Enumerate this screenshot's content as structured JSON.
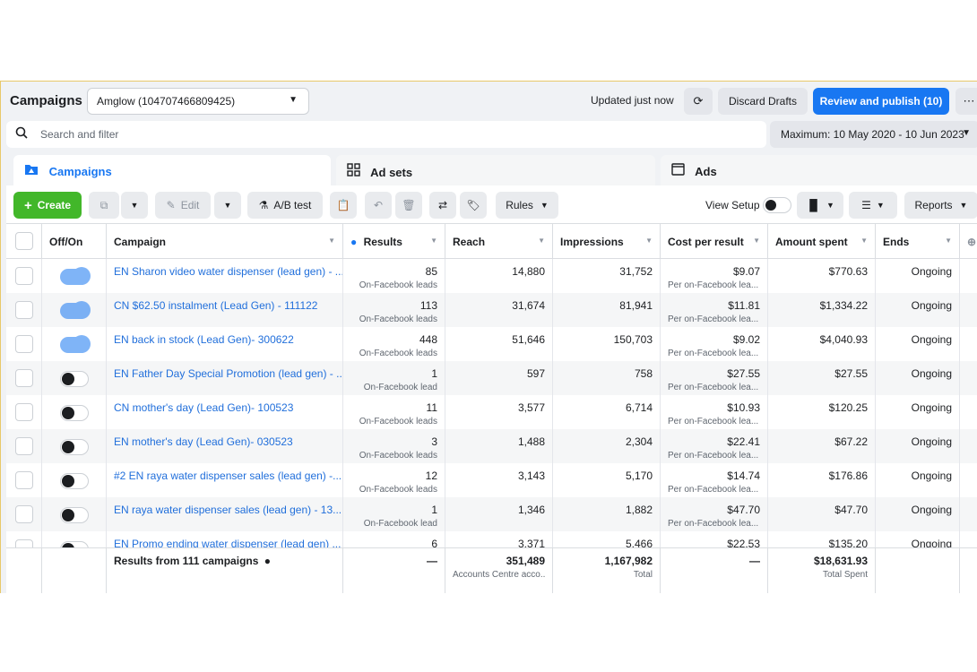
{
  "header": {
    "title": "Campaigns",
    "account": "Amglow (104707466809425)",
    "updated": "Updated just now",
    "discard": "Discard Drafts",
    "publish": "Review and publish (10)",
    "more": "⋯"
  },
  "search": {
    "placeholder": "Search and filter",
    "date_range": "Maximum: 10 May 2020 - 10 Jun 2023"
  },
  "tabs": [
    {
      "label": "Campaigns",
      "active": true
    },
    {
      "label": "Ad sets",
      "active": false
    },
    {
      "label": "Ads",
      "active": false
    }
  ],
  "toolbar": {
    "create": "Create",
    "edit": "Edit",
    "ab_test": "A/B test",
    "rules": "Rules",
    "view_setup": "View Setup",
    "reports": "Reports"
  },
  "columns": [
    "Off/On",
    "Campaign",
    "Results",
    "Reach",
    "Impressions",
    "Cost per result",
    "Amount spent",
    "Ends"
  ],
  "rows": [
    {
      "on": true,
      "name": "EN Sharon video water dispenser (lead gen) - ...",
      "results": "85",
      "results_sub": "On-Facebook leads",
      "reach": "14,880",
      "impressions": "31,752",
      "cpr": "$9.07",
      "cpr_sub": "Per on-Facebook lea...",
      "spent": "$770.63",
      "ends": "Ongoing"
    },
    {
      "on": true,
      "name": "CN $62.50 instalment (Lead Gen) - 111122",
      "results": "113",
      "results_sub": "On-Facebook leads",
      "reach": "31,674",
      "impressions": "81,941",
      "cpr": "$11.81",
      "cpr_sub": "Per on-Facebook lea...",
      "spent": "$1,334.22",
      "ends": "Ongoing"
    },
    {
      "on": true,
      "name": "EN back in stock (Lead Gen)- 300622",
      "results": "448",
      "results_sub": "On-Facebook leads",
      "reach": "51,646",
      "impressions": "150,703",
      "cpr": "$9.02",
      "cpr_sub": "Per on-Facebook lea...",
      "spent": "$4,040.93",
      "ends": "Ongoing"
    },
    {
      "on": false,
      "name": "EN Father Day Special Promotion (lead gen) - ...",
      "results": "1",
      "results_sub": "On-Facebook lead",
      "reach": "597",
      "impressions": "758",
      "cpr": "$27.55",
      "cpr_sub": "Per on-Facebook lea...",
      "spent": "$27.55",
      "ends": "Ongoing"
    },
    {
      "on": false,
      "name": "CN mother's day (Lead Gen)- 100523",
      "results": "11",
      "results_sub": "On-Facebook leads",
      "reach": "3,577",
      "impressions": "6,714",
      "cpr": "$10.93",
      "cpr_sub": "Per on-Facebook lea...",
      "spent": "$120.25",
      "ends": "Ongoing"
    },
    {
      "on": false,
      "name": "EN mother's day (Lead Gen)- 030523",
      "results": "3",
      "results_sub": "On-Facebook leads",
      "reach": "1,488",
      "impressions": "2,304",
      "cpr": "$22.41",
      "cpr_sub": "Per on-Facebook lea...",
      "spent": "$67.22",
      "ends": "Ongoing"
    },
    {
      "on": false,
      "name": "#2 EN raya water dispenser sales (lead gen) -...",
      "results": "12",
      "results_sub": "On-Facebook leads",
      "reach": "3,143",
      "impressions": "5,170",
      "cpr": "$14.74",
      "cpr_sub": "Per on-Facebook lea...",
      "spent": "$176.86",
      "ends": "Ongoing"
    },
    {
      "on": false,
      "name": "EN raya water dispenser sales (lead gen) - 13...",
      "results": "1",
      "results_sub": "On-Facebook lead",
      "reach": "1,346",
      "impressions": "1,882",
      "cpr": "$47.70",
      "cpr_sub": "Per on-Facebook lea...",
      "spent": "$47.70",
      "ends": "Ongoing"
    },
    {
      "on": false,
      "name": "EN Promo ending water dispenser (lead gen) ...",
      "results": "6",
      "results_sub": "",
      "reach": "3,371",
      "impressions": "5,466",
      "cpr": "$22.53",
      "cpr_sub": "",
      "spent": "$135.20",
      "ends": "Ongoing"
    }
  ],
  "footer": {
    "label": "Results from 111 campaigns",
    "results": "—",
    "reach": "351,489",
    "reach_sub": "Accounts Centre acco...",
    "impressions": "1,167,982",
    "impressions_sub": "Total",
    "cpr": "—",
    "spent": "$18,631.93",
    "spent_sub": "Total Spent"
  }
}
